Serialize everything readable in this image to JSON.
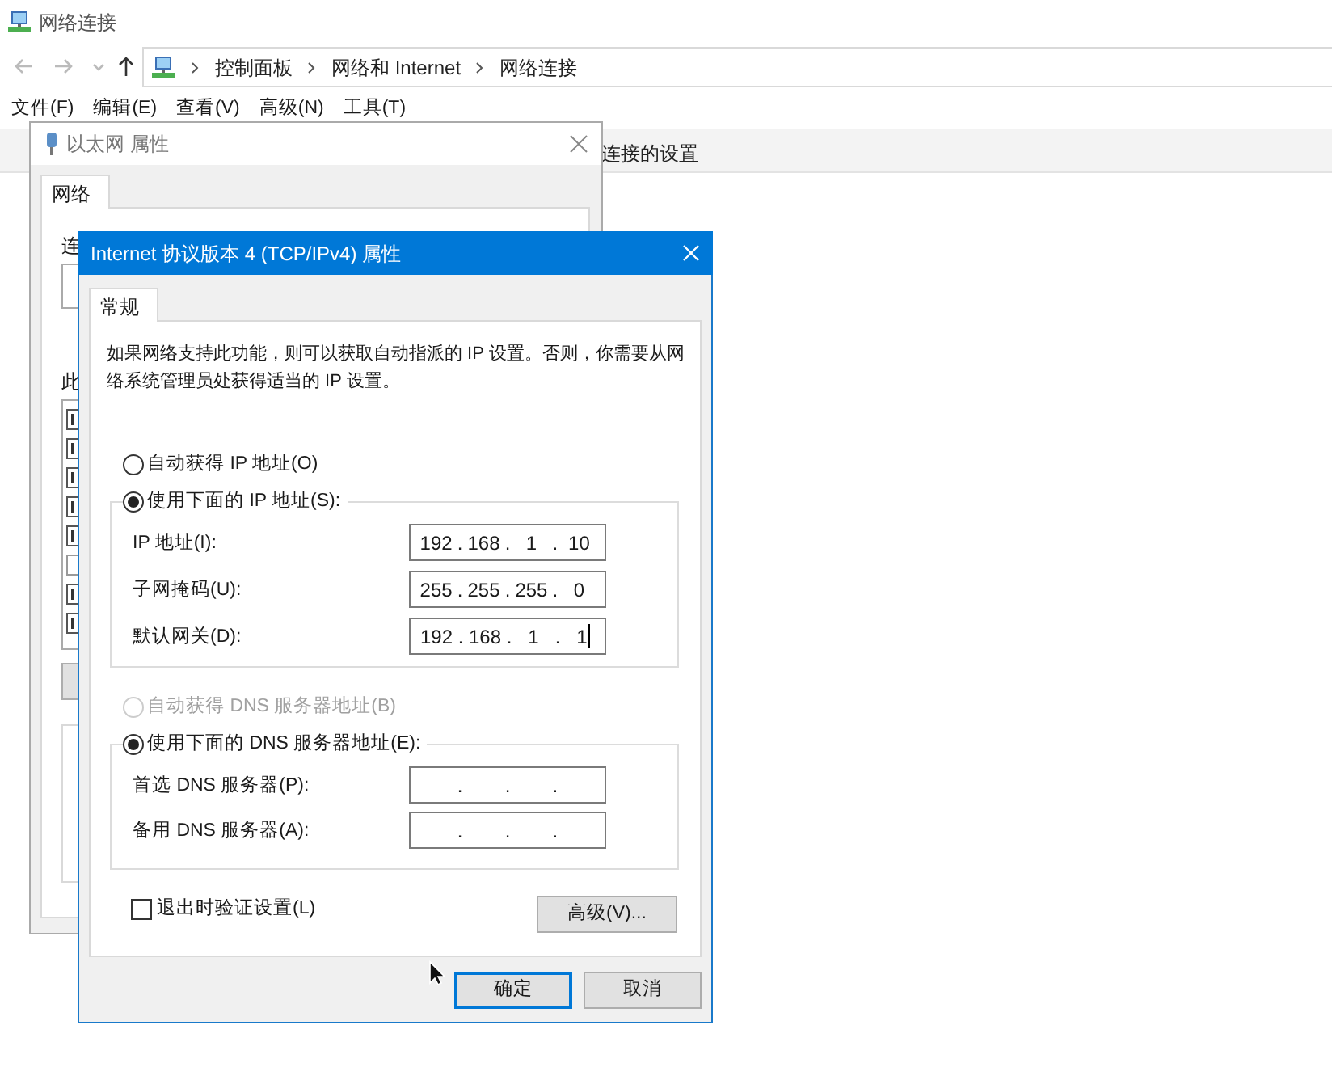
{
  "explorer": {
    "title": "网络连接",
    "breadcrumbs": [
      "控制面板",
      "网络和 Internet",
      "网络连接"
    ],
    "menu": [
      "文件(F)",
      "编辑(E)",
      "查看(V)",
      "高级(N)",
      "工具(T)"
    ],
    "toolbar_text": "连接的设置"
  },
  "ethernet": {
    "title": "以太网 属性",
    "tab": "网络",
    "label_1": "连",
    "label_2": "此",
    "components": [
      {
        "checked": true
      },
      {
        "checked": true
      },
      {
        "checked": true
      },
      {
        "checked": true
      },
      {
        "checked": true
      },
      {
        "checked": false
      },
      {
        "checked": true
      },
      {
        "checked": true
      }
    ]
  },
  "ipv4": {
    "title": "Internet 协议版本 4 (TCP/IPv4) 属性",
    "tab": "常规",
    "description": "如果网络支持此功能，则可以获取自动指派的 IP 设置。否则，你需要从网络系统管理员处获得适当的 IP 设置。",
    "ip_modes": [
      {
        "label": "自动获得 IP 地址(O)",
        "selected": false,
        "disabled": false
      },
      {
        "label": "使用下面的 IP 地址(S):",
        "selected": true,
        "disabled": false
      }
    ],
    "ip_fields": [
      {
        "label": "IP 地址(I):",
        "octets": [
          "192",
          "168",
          "1",
          "10"
        ],
        "dot": ".",
        "caret": false
      },
      {
        "label": "子网掩码(U):",
        "octets": [
          "255",
          "255",
          "255",
          "0"
        ],
        "dot": ".",
        "caret": false
      },
      {
        "label": "默认网关(D):",
        "octets": [
          "192",
          "168",
          "1",
          "1"
        ],
        "dot": ".",
        "caret": true
      }
    ],
    "dns_modes": [
      {
        "label": "自动获得 DNS 服务器地址(B)",
        "selected": false,
        "disabled": true
      },
      {
        "label": "使用下面的 DNS 服务器地址(E):",
        "selected": true,
        "disabled": false
      }
    ],
    "dns_fields": [
      {
        "label": "首选 DNS 服务器(P):",
        "dot": ".",
        "caret": false
      },
      {
        "label": "备用 DNS 服务器(A):",
        "dot": ".",
        "caret": false
      }
    ],
    "validate": {
      "label": "退出时验证设置(L)",
      "checked": false
    },
    "advanced": "高级(V)...",
    "ok": "确定",
    "cancel": "取消"
  }
}
